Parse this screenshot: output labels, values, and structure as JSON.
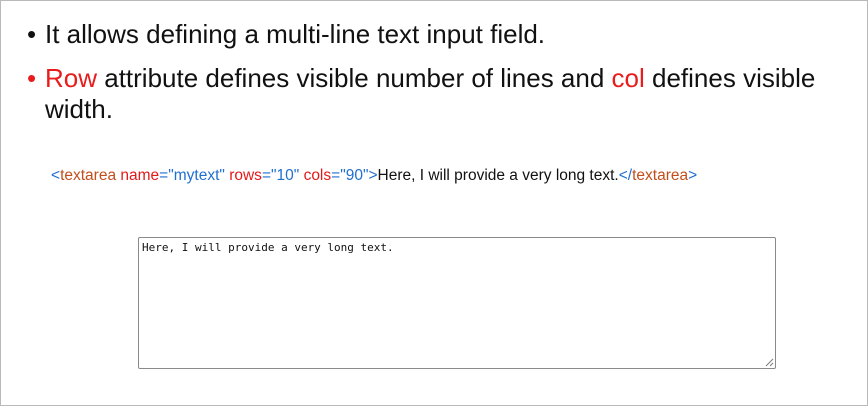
{
  "bullets": [
    {
      "marker": "•",
      "text": "It allows defining a multi-line text input field."
    },
    {
      "marker": "•",
      "highlight1": "Row",
      "text1": " attribute defines visible number of lines and ",
      "highlight2": "col",
      "text2": " defines visible width."
    }
  ],
  "code": {
    "open_bracket": "<",
    "tag": "textarea",
    "attr_name": "name",
    "eq": "=",
    "name_value": "\"mytext\"",
    "attr_rows": "rows",
    "rows_value": "\"10\"",
    "attr_cols": "cols",
    "cols_value": "\"90\"",
    "close_bracket": ">",
    "content": "Here, I will provide a very long text.",
    "end_open": "</",
    "end_close": ">"
  },
  "textarea": {
    "value": "Here, I will provide a very long text.",
    "rows": "10",
    "cols": "90",
    "name": "mytext"
  },
  "colors": {
    "highlight_red": "#e81c1c",
    "code_blue": "#1f6fd1",
    "code_tag": "#c24f1b",
    "code_attr": "#e21a1a"
  },
  "icons": {
    "resize_handle": "resize-grip-icon"
  }
}
